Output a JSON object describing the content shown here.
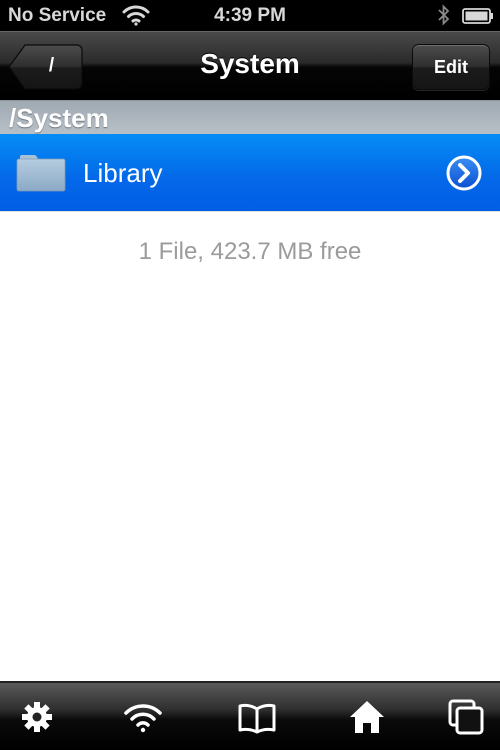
{
  "status_bar": {
    "carrier": "No Service",
    "time": "4:39 PM",
    "icons": [
      "wifi-icon",
      "bluetooth-icon",
      "battery-icon"
    ]
  },
  "nav_bar": {
    "back_label": "/",
    "title": "System",
    "edit_label": "Edit"
  },
  "section_header": {
    "path": "/System"
  },
  "files": [
    {
      "name": "Library",
      "type": "folder",
      "icon": "folder-icon",
      "accessory": "disclosure-icon",
      "selected": true
    }
  ],
  "footer": {
    "summary": "1 File, 423.7 MB free"
  },
  "toolbar": {
    "items": [
      {
        "name": "settings",
        "icon": "gear-icon"
      },
      {
        "name": "wifi-sharing",
        "icon": "wifi-icon"
      },
      {
        "name": "bookmarks",
        "icon": "book-icon"
      },
      {
        "name": "home",
        "icon": "home-icon"
      },
      {
        "name": "windows",
        "icon": "windows-icon"
      }
    ]
  },
  "colors": {
    "selection_blue": "#0467e8",
    "header_gray": "#b0b8bf",
    "footer_text": "#9b9b9b"
  }
}
